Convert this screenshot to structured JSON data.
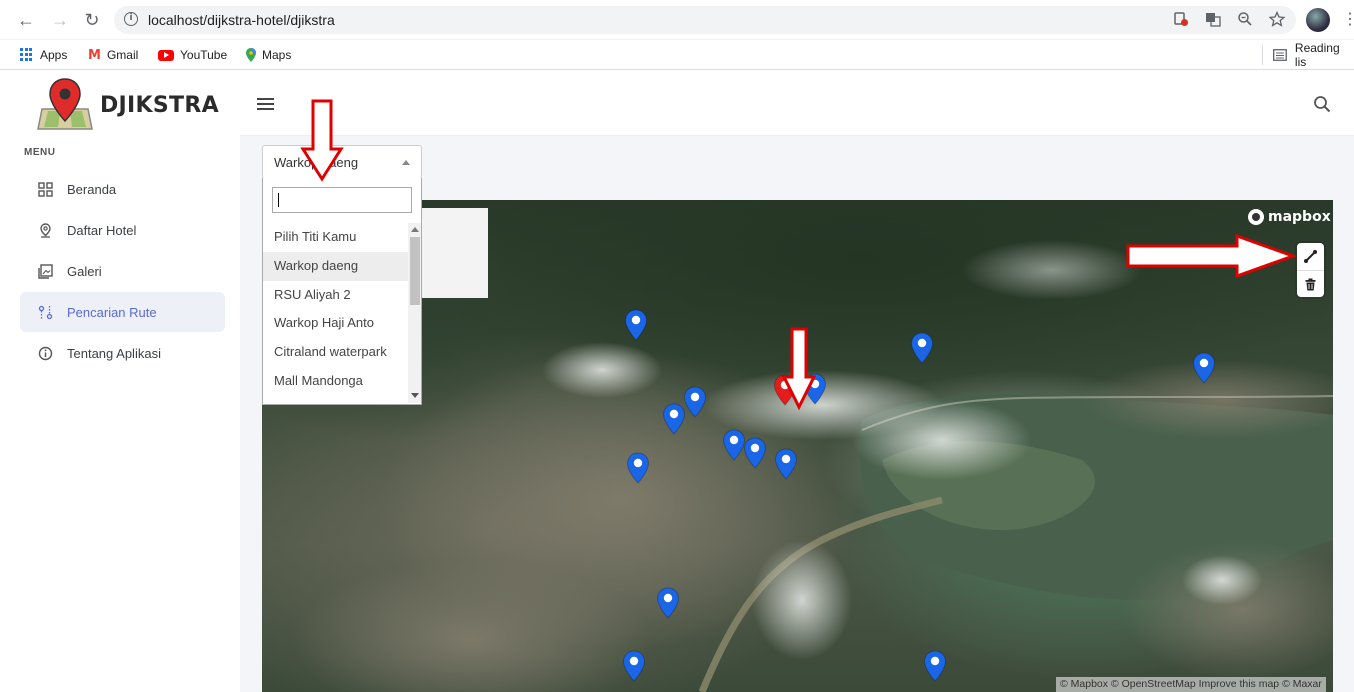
{
  "browser": {
    "url": "localhost/dijkstra-hotel/djikstra",
    "bookmarks": [
      {
        "label": "Apps"
      },
      {
        "label": "Gmail"
      },
      {
        "label": "YouTube"
      },
      {
        "label": "Maps"
      }
    ],
    "reading_list": "Reading lis"
  },
  "app": {
    "brand": "DJIKSTRA",
    "menu_title": "MENU",
    "menu": [
      {
        "label": "Beranda",
        "icon": "grid-icon"
      },
      {
        "label": "Daftar Hotel",
        "icon": "location-pin-icon"
      },
      {
        "label": "Galeri",
        "icon": "gallery-icon"
      },
      {
        "label": "Pencarian Rute",
        "icon": "route-icon",
        "active": true
      },
      {
        "label": "Tentang Aplikasi",
        "icon": "info-icon"
      }
    ]
  },
  "select": {
    "value": "Warkop daeng",
    "search_value": "",
    "options": [
      "Pilih Titi Kamu",
      "Warkop daeng",
      "RSU Aliyah 2",
      "Warkop Haji Anto",
      "Citraland waterpark",
      "Mall Mandonga"
    ],
    "selected_index": 1
  },
  "map": {
    "logo": "mapbox",
    "attribution": "© Mapbox © OpenStreetMap Improve this map © Maxar",
    "controls": [
      "line-draw-icon",
      "trash-icon"
    ],
    "marker_colors": {
      "default": "#1a66e6",
      "selected": "#e51c1c"
    }
  },
  "colors": {
    "accent": "#5a6ad6",
    "annotation_arrow": "#e00000"
  }
}
